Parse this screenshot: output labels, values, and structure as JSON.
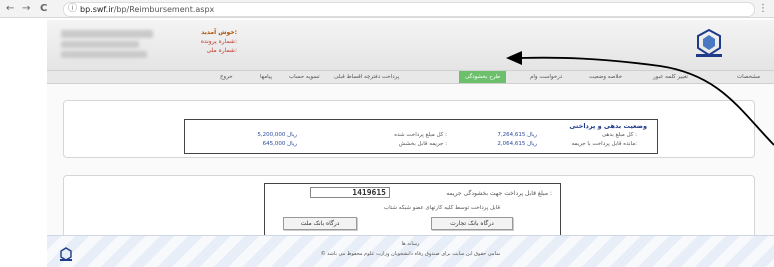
{
  "browser": {
    "back": "←",
    "forward": "→",
    "reload": "C",
    "url_host": "bp.swf.ir",
    "url_path": "/bp/Reimbursement.aspx",
    "menu": "⋮"
  },
  "header": {
    "welcome": "خوش آمدید:",
    "tracking_number": "شماره پرونده:",
    "national_id": "شماره ملی:"
  },
  "nav": {
    "items": [
      {
        "label": "خروج"
      },
      {
        "label": "پیامها"
      },
      {
        "label": "تسویه حساب"
      },
      {
        "label": "پرداخت دفترچه اقساط قبلی"
      },
      {
        "label": "طرح بخشودگی"
      },
      {
        "label": "درخواست وام"
      },
      {
        "label": "خلاصه وضعیت"
      },
      {
        "label": "تغییر کلمه عبور"
      },
      {
        "label": "مشخصات"
      }
    ]
  },
  "status": {
    "title": "وضعیت بدهی و پرداختی",
    "total_debt_label": "کل مبلغ بدهی :",
    "total_debt_value": "7,264,615 ریال",
    "remaining_label": "مانده قابل پرداخت با جریمه:",
    "remaining_value": "2,064,615 ریال",
    "paid_label": "کل مبلغ پرداخت شده :",
    "paid_value": "5,200,000 ریال",
    "forgivable_label": "جریمه قابل بخشش :",
    "forgivable_value": "645,000 ریال"
  },
  "fine": {
    "label": "مبلغ قابل پرداخت جهت بخشودگی جریمه :",
    "amount": "1419615",
    "note": "قابل پرداخت توسط کلیه کارتهای عضو شبکه شتاب",
    "btn_tejarat": "درگاه بانک تجارت",
    "btn_melli": "درگاه بانک ملت"
  },
  "footer": {
    "line1": "رسانه ها",
    "line2": "© تمامی حقوق این سایت برای صندوق رفاه دانشجویان وزارت علوم محفوظ می باشد"
  },
  "colors": {
    "active_tab": "#6cc06c",
    "value_text": "#2b4a9a",
    "title": "#1e3a8a"
  }
}
